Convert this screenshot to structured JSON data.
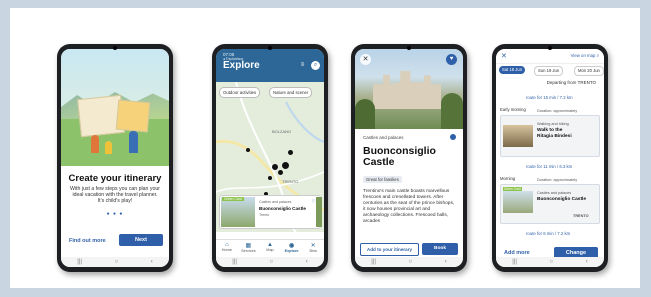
{
  "phone1": {
    "title": "Create your itinerary",
    "text": "With just a few steps you can plan your ideal vacation with the travel planner. It's child's play!",
    "dots": "● ● ●",
    "find_out_more": "Find out more",
    "next": "Next"
  },
  "phone2": {
    "status": "07:05",
    "status_sub": "◂ TripAdvisor",
    "title": "Explore",
    "chips": [
      "Outdoor activities",
      "Nature and scener"
    ],
    "map_labels": [
      "BOLZANO",
      "TRENTO",
      "ROVERETO"
    ],
    "card": {
      "badge": "Green Card",
      "category": "Castles and palaces",
      "name": "Buonconsiglio Castle",
      "place": "Trento"
    },
    "tabs": [
      "Home",
      "Services",
      "Map",
      "Explore",
      "Bins"
    ]
  },
  "phone3": {
    "category": "Castles and palaces",
    "title": "Buonconsiglio Castle",
    "badge": "Great for families",
    "description": "Trentino's main castle boasts marvellous frescoes and crenellated towers. After centuries as the seat of the prince bishops, it now houses provincial art and archaeology collections. Frescoed halls, arcades",
    "add": "Add to your itinerary",
    "book": "Book"
  },
  "phone4": {
    "view_on_map": "View on map ⌕",
    "days": [
      "Sat 18 Jun",
      "Sun 19 Jun",
      "Mon 20 Jun"
    ],
    "departing": "Departing from TRENTO",
    "routes": [
      "route for 15 min / 7.2 km",
      "route for 11 min / 6.3 km",
      "route for 6 min / 7.2 km"
    ],
    "slots": [
      {
        "label": "Early morning",
        "duration": "Duration: approximately",
        "kind": "Walking and hiking",
        "name": "Walk to the Ritagia Bindesi"
      },
      {
        "label": "Morning",
        "duration": "Duration: approximately",
        "badge": "Green Card",
        "kind": "Castles and palaces",
        "name": "Buonconsiglio Castle",
        "place": "TRENTO"
      }
    ],
    "add_more": "Add more",
    "change": "Change"
  },
  "colors": {
    "brand_blue": "#2f5fa8",
    "header_blue": "#2d6797"
  },
  "icons": [
    "back-icon",
    "home-icon",
    "recents-icon",
    "search-icon",
    "heart-icon",
    "close-icon",
    "map-pin-icon"
  ]
}
